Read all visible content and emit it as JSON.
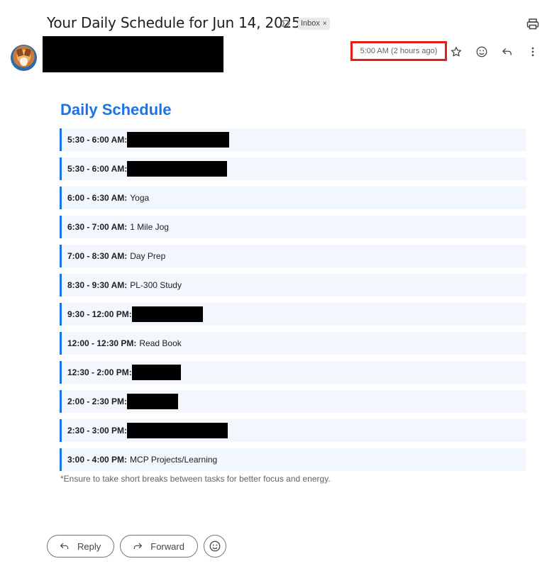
{
  "header": {
    "subject": "Your Daily Schedule for Jun 14, 2025",
    "label_chip": "Inbox",
    "label_chip_close": "×",
    "timestamp": "5:00 AM (2 hours ago)",
    "highlight_color": "#e3201b"
  },
  "message": {
    "heading": "Daily Schedule",
    "accent_color": "#1a73e8",
    "items": [
      {
        "time": "5:30 - 6:00 AM:",
        "task": "",
        "redacted": true
      },
      {
        "time": "5:30 - 6:00 AM:",
        "task": "",
        "redacted": true
      },
      {
        "time": "6:00 - 6:30 AM:",
        "task": "Yoga",
        "redacted": false
      },
      {
        "time": "6:30 - 7:00 AM:",
        "task": "1 Mile Jog",
        "redacted": false
      },
      {
        "time": "7:00 - 8:30 AM:",
        "task": "Day Prep",
        "redacted": false
      },
      {
        "time": "8:30 - 9:30 AM:",
        "task": "PL-300 Study",
        "redacted": false
      },
      {
        "time": "9:30 - 12:00 PM:",
        "task": "",
        "redacted": true
      },
      {
        "time": "12:00 - 12:30 PM:",
        "task": "Read Book",
        "redacted": false
      },
      {
        "time": "12:30 - 2:00 PM:",
        "task": "",
        "redacted": true
      },
      {
        "time": "2:00 - 2:30 PM:",
        "task": "",
        "redacted": true
      },
      {
        "time": "2:30 - 3:00 PM:",
        "task": "",
        "redacted": true
      },
      {
        "time": "3:00 - 4:00 PM:",
        "task": "MCP Projects/Learning",
        "redacted": false
      }
    ],
    "note": "*Ensure to take short breaks between tasks for better focus and energy."
  },
  "actions": {
    "reply_label": "Reply",
    "forward_label": "Forward"
  },
  "icons": {
    "label_importance": "label-importance-icon",
    "print": "print-icon",
    "star": "star-icon",
    "emoji": "emoji-icon",
    "reply": "reply-icon",
    "more": "more-vert-icon",
    "forward": "forward-icon"
  }
}
